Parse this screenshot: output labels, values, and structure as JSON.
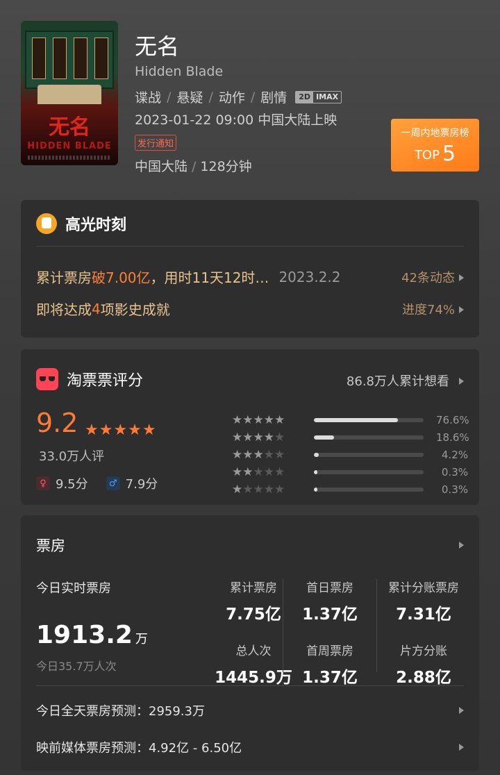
{
  "movie": {
    "poster_title": "无名",
    "poster_en": "HIDDEN BLADE",
    "title": "无名",
    "en_title": "Hidden Blade",
    "genres": [
      "谍战",
      "悬疑",
      "动作",
      "剧情"
    ],
    "format_2d": "2D",
    "format_imax": "IMAX",
    "release": "2023-01-22 09:00 中国大陆上映",
    "notice": "发行通知",
    "region": "中国大陆",
    "duration": "128分钟"
  },
  "rank": {
    "label": "一周内地票房榜",
    "prefix": "TOP",
    "number": "5"
  },
  "highlight": {
    "title": "高光时刻",
    "row1_prefix": "累计票房 ",
    "row1_hot": "破7.00亿",
    "row1_suffix": "，用时11天12时…",
    "row1_date": "2023.2.2",
    "row1_right": "42条动态",
    "row2_prefix": "即将达成 ",
    "row2_hot": "4",
    "row2_suffix": "项影史成就",
    "row2_right": "进度74%"
  },
  "taopiaopiao": {
    "title": "淘票票评分",
    "want": "86.8万人累计想看",
    "score": "9.2",
    "big_stars": "★★★★★",
    "rating_count": "33.0万人评",
    "female_score": "9.5分",
    "male_score": "7.9分",
    "distribution": [
      {
        "stars": 5,
        "pct": "76.6%",
        "value": 76.6
      },
      {
        "stars": 4,
        "pct": "18.6%",
        "value": 18.6
      },
      {
        "stars": 3,
        "pct": "4.2%",
        "value": 4.2
      },
      {
        "stars": 2,
        "pct": "0.3%",
        "value": 0.3
      },
      {
        "stars": 1,
        "pct": "0.3%",
        "value": 0.3
      }
    ]
  },
  "boxoffice": {
    "title": "票房",
    "today_label": "今日实时票房",
    "today_value": "1913.2",
    "today_unit": "万",
    "today_people": "今日35.7万人次",
    "cumulative_label": "累计票房",
    "cumulative_value": "7.75亿",
    "total_people_label": "总人次",
    "total_people_value": "1445.9万",
    "first_day_label": "首日票房",
    "first_day_value": "1.37亿",
    "first_week_label": "首周票房",
    "first_week_value": "1.37亿",
    "split_label": "累计分账票房",
    "split_value": "7.31亿",
    "producer_label": "片方分账",
    "producer_value": "2.88亿",
    "forecast_today": "今日全天票房预测：2959.3万",
    "forecast_media": "映前媒体票房预测：4.92亿 - 6.50亿"
  },
  "colors": {
    "accent": "#ff7a33",
    "gold": "#e8c48e",
    "card": "#2e2e2e",
    "rank_bg": "#ff8a22"
  }
}
